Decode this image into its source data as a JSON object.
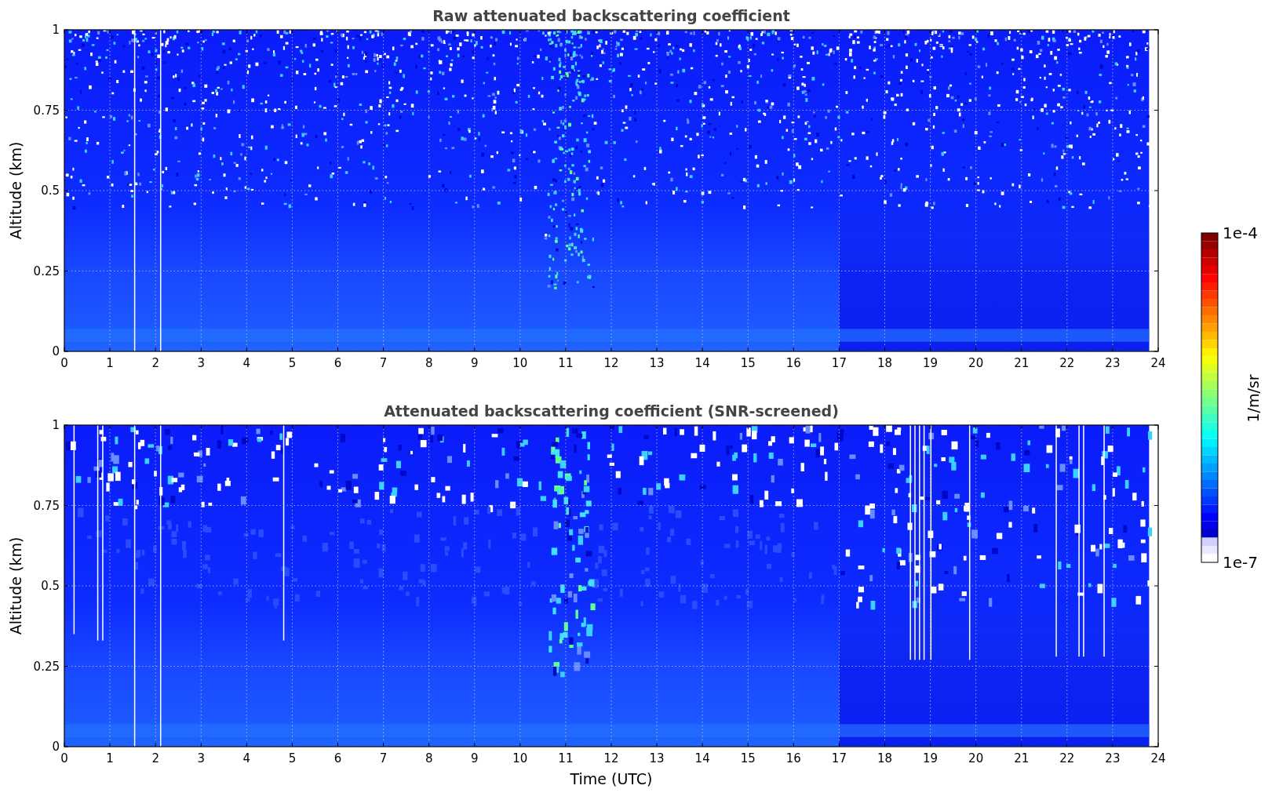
{
  "panels": [
    {
      "title": "Raw attenuated backscattering coefficient",
      "ylabel": "Altitude (km)",
      "yticks": [
        "1",
        "0.75",
        "0.5",
        "0.25",
        "0"
      ],
      "xticks": [
        "0",
        "1",
        "2",
        "3",
        "4",
        "5",
        "6",
        "7",
        "8",
        "9",
        "10",
        "11",
        "12",
        "13",
        "14",
        "15",
        "16",
        "17",
        "18",
        "19",
        "20",
        "21",
        "22",
        "23",
        "24"
      ]
    },
    {
      "title": "Attenuated backscattering coefficient (SNR-screened)",
      "ylabel": "Altitude (km)",
      "yticks": [
        "1",
        "0.75",
        "0.5",
        "0.25",
        "0"
      ],
      "xticks": [
        "0",
        "1",
        "2",
        "3",
        "4",
        "5",
        "6",
        "7",
        "8",
        "9",
        "10",
        "11",
        "12",
        "13",
        "14",
        "15",
        "16",
        "17",
        "18",
        "19",
        "20",
        "21",
        "22",
        "23",
        "24"
      ],
      "xlabel": "Time (UTC)"
    }
  ],
  "colorbar": {
    "max": "1e-4",
    "min": "1e-7",
    "label": "1/m/sr"
  }
}
